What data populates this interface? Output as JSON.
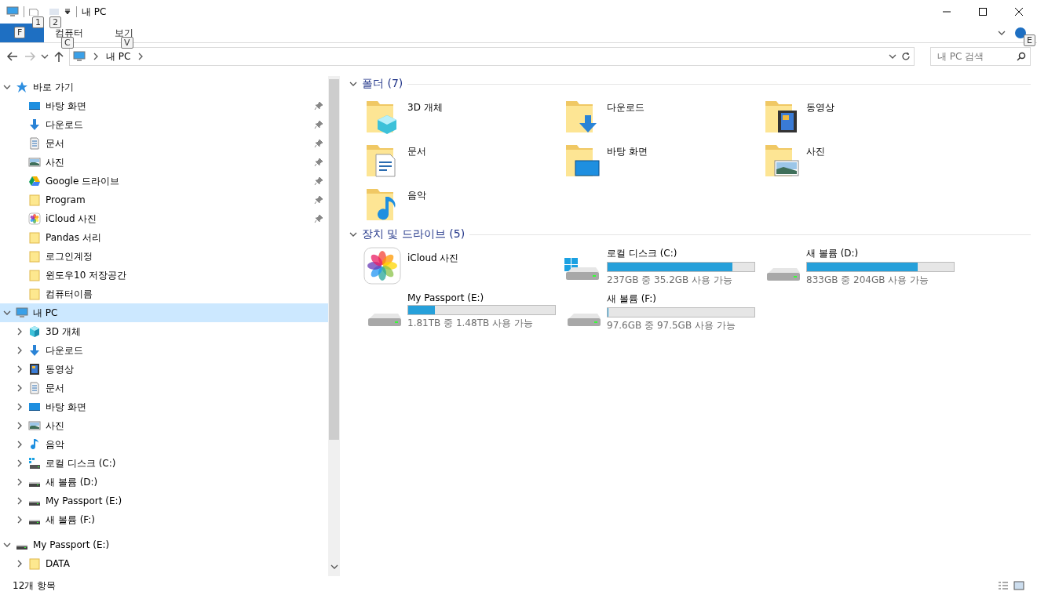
{
  "window": {
    "title": "내 PC",
    "qat_keytips": [
      "1",
      "2"
    ]
  },
  "ribbon": {
    "tabs": [
      {
        "kind": "file",
        "keytip": "F"
      },
      {
        "kind": "tab",
        "label": "컴퓨터",
        "keytip": "C"
      },
      {
        "kind": "tab",
        "label": "보기",
        "keytip": "V"
      }
    ],
    "help_keytip": "E"
  },
  "address": {
    "path": [
      "내 PC"
    ],
    "search": {
      "placeholder": "내 PC 검색"
    }
  },
  "navigation": [
    {
      "label": "바로 가기",
      "kind": "star",
      "expanded": true,
      "selected": false,
      "children": [
        {
          "label": "바탕 화면",
          "kind": "desktop",
          "pinned": true
        },
        {
          "label": "다운로드",
          "kind": "download",
          "pinned": true
        },
        {
          "label": "문서",
          "kind": "document",
          "pinned": true
        },
        {
          "label": "사진",
          "kind": "picture",
          "pinned": true
        },
        {
          "label": "Google 드라이브",
          "kind": "gdrive",
          "pinned": true
        },
        {
          "label": "Program",
          "kind": "folder",
          "pinned": true
        },
        {
          "label": "iCloud 사진",
          "kind": "icloud",
          "pinned": true
        },
        {
          "label": "Pandas 서리",
          "kind": "folder",
          "pinned": false
        },
        {
          "label": "로그인계정",
          "kind": "folder",
          "pinned": false
        },
        {
          "label": "윈도우10 저장공간",
          "kind": "folder",
          "pinned": false
        },
        {
          "label": "컴퓨터이름",
          "kind": "folder",
          "pinned": false
        }
      ]
    },
    {
      "label": "내 PC",
      "kind": "pc",
      "expanded": true,
      "selected": true,
      "children": [
        {
          "label": "3D 개체",
          "kind": "cube",
          "expandable": true
        },
        {
          "label": "다운로드",
          "kind": "download",
          "expandable": true
        },
        {
          "label": "동영상",
          "kind": "video",
          "expandable": true
        },
        {
          "label": "문서",
          "kind": "document",
          "expandable": true
        },
        {
          "label": "바탕 화면",
          "kind": "desktop",
          "expandable": true
        },
        {
          "label": "사진",
          "kind": "picture",
          "expandable": true
        },
        {
          "label": "음악",
          "kind": "music",
          "expandable": true
        },
        {
          "label": "로컬 디스크 (C:)",
          "kind": "windrive",
          "expandable": true
        },
        {
          "label": "새 볼륨 (D:)",
          "kind": "drive",
          "expandable": true
        },
        {
          "label": "My Passport (E:)",
          "kind": "drive",
          "expandable": true
        },
        {
          "label": "새 볼륨 (F:)",
          "kind": "drive",
          "expandable": true
        }
      ]
    },
    {
      "label": "My Passport (E:)",
      "kind": "drive",
      "expanded": true,
      "selected": false,
      "children": [
        {
          "label": "DATA",
          "kind": "folder",
          "expandable": true
        }
      ]
    }
  ],
  "folders": {
    "title": "폴더 (7)",
    "items": [
      {
        "label": "3D 개체",
        "kind": "cube"
      },
      {
        "label": "다운로드",
        "kind": "download"
      },
      {
        "label": "동영상",
        "kind": "video"
      },
      {
        "label": "문서",
        "kind": "document"
      },
      {
        "label": "바탕 화면",
        "kind": "desktop"
      },
      {
        "label": "사진",
        "kind": "picture"
      },
      {
        "label": "음악",
        "kind": "music"
      }
    ]
  },
  "drives": {
    "title": "장치 및 드라이브 (5)",
    "items": [
      {
        "label": "iCloud 사진",
        "kind": "icloud"
      },
      {
        "label": "로컬 디스크 (C:)",
        "kind": "windrive",
        "level": 0.85,
        "space": "237GB 중 35.2GB 사용 가능"
      },
      {
        "label": "새 볼륨 (D:)",
        "kind": "drive",
        "level": 0.755,
        "space": "833GB 중 204GB 사용 가능"
      },
      {
        "label": "My Passport (E:)",
        "kind": "drive",
        "level": 0.18,
        "space": "1.81TB 중 1.48TB 사용 가능"
      },
      {
        "label": "새 볼륨 (F:)",
        "kind": "drive",
        "level": 0.001,
        "space": "97.6GB 중 97.5GB 사용 가능"
      }
    ]
  },
  "status_bar": {
    "count": "12개 항목"
  }
}
